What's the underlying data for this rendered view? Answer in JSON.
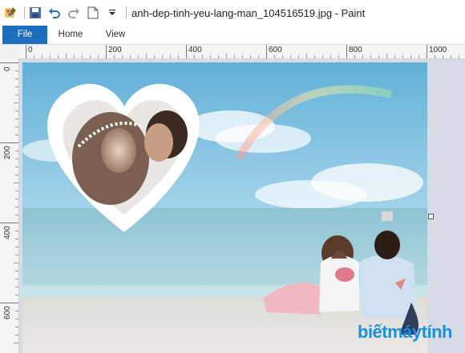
{
  "titlebar": {
    "title": "anh-dep-tinh-yeu-lang-man_104516519.jpg - Paint",
    "icons": [
      "paint-app-icon",
      "save-icon",
      "undo-icon",
      "redo-icon",
      "new-file-icon",
      "customize-dropdown-icon"
    ]
  },
  "ribbon": {
    "tabs": [
      {
        "label": "File"
      },
      {
        "label": "Home"
      },
      {
        "label": "View"
      }
    ]
  },
  "ruler": {
    "horizontal_labels": [
      "0",
      "200",
      "400",
      "600",
      "800",
      "1000"
    ],
    "vertical_labels": [
      "0",
      "200",
      "400",
      "600"
    ]
  },
  "canvas": {
    "watermark_part1": "biết",
    "watermark_part2": "máytính"
  },
  "colors": {
    "accent": "#1e6ec0",
    "canvas_bg": "#d7dbe6",
    "sky_top": "#6fb6da",
    "sea": "#9ccbd8",
    "sand": "#e9e6e2"
  }
}
